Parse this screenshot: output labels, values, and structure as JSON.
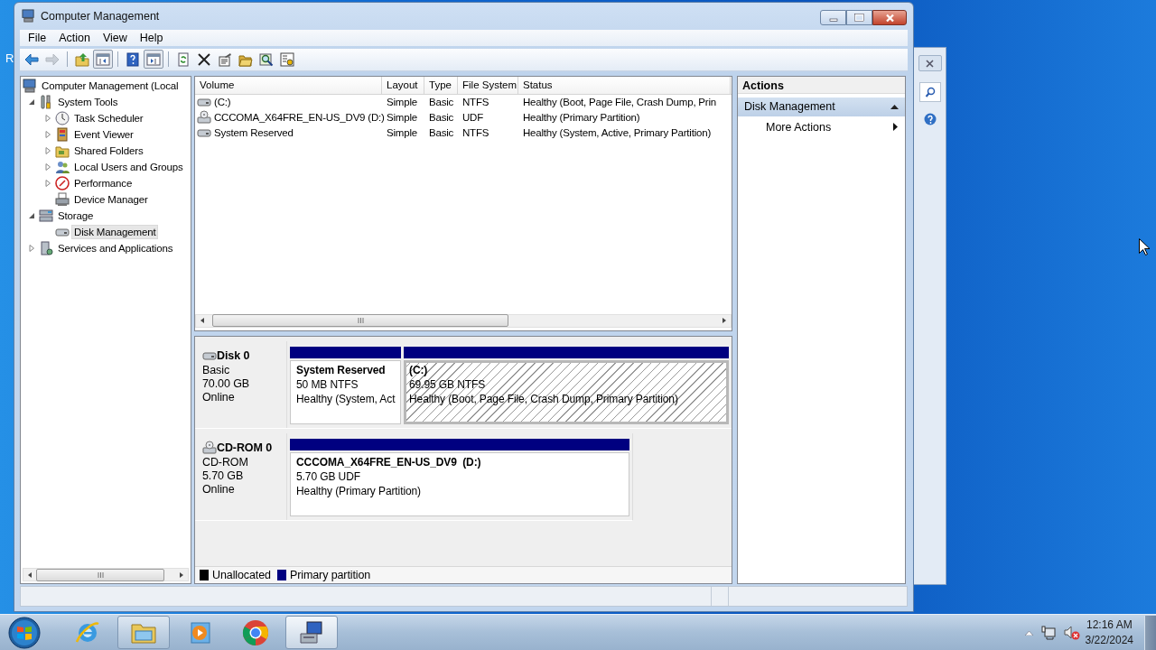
{
  "desktop_text": "R",
  "window": {
    "title": "Computer Management"
  },
  "menu": [
    "File",
    "Action",
    "View",
    "Help"
  ],
  "toolbar": [
    {
      "pressed": false,
      "disabled": false
    },
    {
      "pressed": false,
      "disabled": true
    },
    {
      "pressed": false,
      "disabled": false
    },
    {
      "pressed": true,
      "disabled": false
    },
    {
      "pressed": false,
      "disabled": false
    },
    {
      "pressed": true,
      "disabled": false
    },
    {
      "pressed": false,
      "disabled": false
    },
    {
      "pressed": false,
      "disabled": false
    },
    {
      "pressed": false,
      "disabled": false
    },
    {
      "pressed": false,
      "disabled": false
    },
    {
      "pressed": false,
      "disabled": false
    },
    {
      "pressed": false,
      "disabled": false
    }
  ],
  "tree": {
    "label": "Computer Management (Local",
    "selected": false,
    "children": [
      {
        "label": "System Tools",
        "expanded": true,
        "selected": false,
        "children": [
          {
            "label": "Task Scheduler",
            "expanded": false,
            "selected": false
          },
          {
            "label": "Event Viewer",
            "expanded": false,
            "selected": false
          },
          {
            "label": "Shared Folders",
            "expanded": false,
            "selected": false
          },
          {
            "label": "Local Users and Groups",
            "expanded": false,
            "selected": false
          },
          {
            "label": "Performance",
            "expanded": false,
            "selected": false
          },
          {
            "label": "Device Manager",
            "selected": false
          }
        ]
      },
      {
        "label": "Storage",
        "expanded": true,
        "selected": false,
        "children": [
          {
            "label": "Disk Management",
            "selected": true
          }
        ]
      },
      {
        "label": "Services and Applications",
        "expanded": false,
        "selected": false
      }
    ]
  },
  "table": {
    "columns": [
      "Volume",
      "Layout",
      "Type",
      "File System",
      "Status"
    ],
    "rows": [
      {
        "kind": "disk",
        "cells": [
          "(C:)",
          "Simple",
          "Basic",
          "NTFS",
          "Healthy (Boot, Page File, Crash Dump, Prin"
        ]
      },
      {
        "kind": "cdrom",
        "cells": [
          "CCCOMA_X64FRE_EN-US_DV9 (D:)",
          "Simple",
          "Basic",
          "UDF",
          "Healthy (Primary Partition)"
        ]
      },
      {
        "kind": "disk",
        "cells": [
          "System Reserved",
          "Simple",
          "Basic",
          "NTFS",
          "Healthy (System, Active, Primary Partition)"
        ]
      }
    ]
  },
  "disk_map": {
    "disks": [
      {
        "kind": "disk",
        "name": "Disk 0",
        "type": "Basic",
        "size": "70.00 GB",
        "status": "Online",
        "partitions": [
          {
            "name": "System Reserved",
            "size": "50 MB NTFS",
            "status": "Healthy (System, Act",
            "color": "#000080",
            "selected": false
          },
          {
            "name": "(C:)",
            "size": "69.95 GB NTFS",
            "status": "Healthy (Boot, Page File, Crash Dump, Primary Partition)",
            "color": "#000080",
            "selected": true
          }
        ]
      },
      {
        "kind": "cdrom",
        "name": "CD-ROM 0",
        "type": "CD-ROM",
        "size": "5.70 GB",
        "status": "Online",
        "partitions": [
          {
            "name": "CCCOMA_X64FRE_EN-US_DV9  (D:)",
            "size": "5.70 GB UDF",
            "status": "Healthy (Primary Partition)",
            "color": "#000080",
            "selected": false
          }
        ]
      }
    ],
    "legend": [
      {
        "label": "Unallocated",
        "color": "#000000"
      },
      {
        "label": "Primary partition",
        "color": "#000080"
      }
    ]
  },
  "actions": {
    "title": "Actions",
    "sections": [
      {
        "label": "Disk Management",
        "expanded": true,
        "items": [
          {
            "label": "More Actions"
          }
        ]
      }
    ]
  },
  "taskbar": {
    "buttons": [
      {
        "running": false,
        "selected": false
      },
      {
        "running": true,
        "selected": false
      },
      {
        "running": false,
        "selected": false
      },
      {
        "running": false,
        "selected": false
      },
      {
        "running": true,
        "selected": true
      }
    ],
    "time": "12:16 AM",
    "date": "3/22/2024"
  }
}
